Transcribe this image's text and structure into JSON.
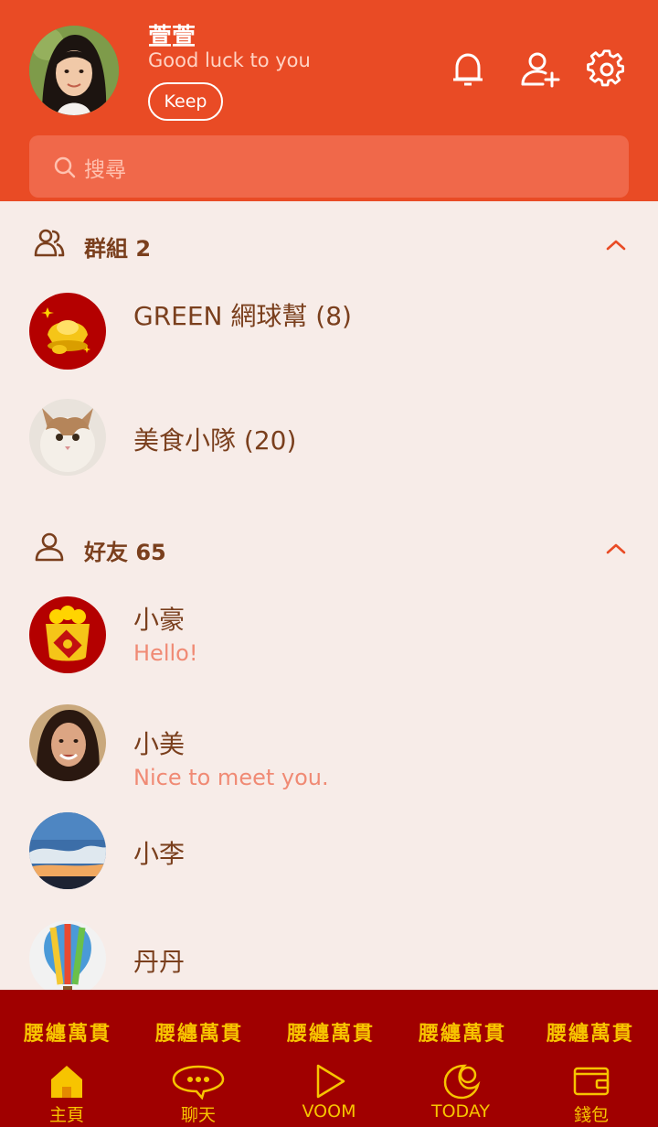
{
  "profile": {
    "name": "萱萱",
    "status": "Good luck to you",
    "keep_label": "Keep"
  },
  "search": {
    "placeholder": "搜尋"
  },
  "groups": {
    "title": "群組 2",
    "items": [
      {
        "name": "GREEN 網球幫 (8)"
      },
      {
        "name": "美食小隊 (20)"
      }
    ]
  },
  "friends": {
    "title": "好友 65",
    "items": [
      {
        "name": "小豪",
        "message": "Hello!"
      },
      {
        "name": "小美",
        "message": "Nice to meet you."
      },
      {
        "name": "小李"
      },
      {
        "name": "丹丹"
      }
    ]
  },
  "banner": {
    "text": "腰纏萬貫"
  },
  "tabs": [
    {
      "label": "主頁",
      "icon": "home-icon",
      "active": true
    },
    {
      "label": "聊天",
      "icon": "chat-icon"
    },
    {
      "label": "VOOM",
      "icon": "play-icon"
    },
    {
      "label": "TODAY",
      "icon": "moon-icon"
    },
    {
      "label": "錢包",
      "icon": "wallet-icon"
    }
  ],
  "colors": {
    "header": "#e94b25",
    "background": "#f7ece8",
    "bottom_bar": "#a00000",
    "gold": "#f7c400",
    "text_brown": "#7a3f1d",
    "message_pink": "#f08a74"
  }
}
